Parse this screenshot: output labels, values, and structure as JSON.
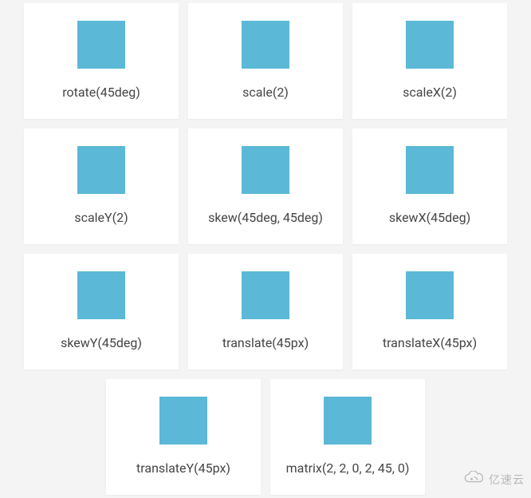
{
  "cards": [
    {
      "label": "rotate(45deg)"
    },
    {
      "label": "scale(2)"
    },
    {
      "label": "scaleX(2)"
    },
    {
      "label": "scaleY(2)"
    },
    {
      "label": "skew(45deg, 45deg)"
    },
    {
      "label": "skewX(45deg)"
    },
    {
      "label": "skewY(45deg)"
    },
    {
      "label": "translate(45px)"
    },
    {
      "label": "translateX(45px)"
    },
    {
      "label": "translateY(45px)"
    },
    {
      "label": "matrix(2, 2, 0, 2, 45, 0)"
    }
  ],
  "swatch_color": "#5bb8d7",
  "watermark": {
    "text": "亿速云"
  }
}
